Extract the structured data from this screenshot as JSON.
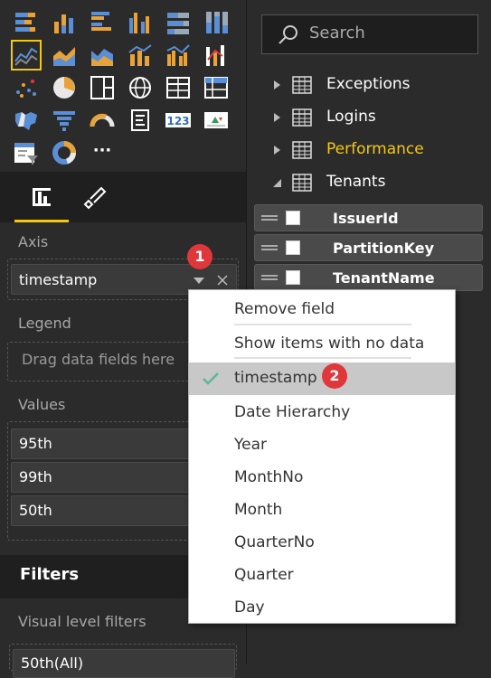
{
  "visualizations": {
    "icons": [
      "stacked-bar-chart-icon",
      "stacked-column-chart-icon",
      "clustered-bar-chart-icon",
      "clustered-column-chart-icon",
      "100pct-stacked-bar-chart-icon",
      "100pct-stacked-column-chart-icon",
      "line-chart-icon",
      "area-chart-icon",
      "stacked-area-chart-icon",
      "line-and-stacked-column-chart-icon",
      "line-and-clustered-column-chart-icon",
      "ribbon-chart-icon",
      "scatter-chart-icon",
      "pie-chart-icon",
      "treemap-icon",
      "globe-map-icon",
      "table-icon",
      "matrix-icon",
      "filled-map-icon",
      "funnel-icon",
      "gauge-icon",
      "card-icon",
      "multi-row-card-icon",
      "kpi-icon",
      "slicer-icon",
      "donut-chart-icon",
      "more-visuals-icon"
    ],
    "more_label": "···",
    "selected": "line-chart-icon"
  },
  "tabs": [
    {
      "name": "fields-tab",
      "icon": "fields-icon",
      "active": true
    },
    {
      "name": "format-tab",
      "icon": "paint-roller-icon",
      "active": false
    }
  ],
  "axis": {
    "label": "Axis",
    "value": "timestamp"
  },
  "legend": {
    "label": "Legend",
    "placeholder": "Drag data fields here"
  },
  "values": {
    "label": "Values",
    "fields": [
      "95th",
      "99th",
      "50th"
    ]
  },
  "filters": {
    "header": "Filters",
    "visual_level_label": "Visual level filters",
    "first_filter": "50th(All)"
  },
  "search": {
    "placeholder": "Search"
  },
  "tables": [
    {
      "name": "Exceptions",
      "expanded": false,
      "color": "#ffffff"
    },
    {
      "name": "Logins",
      "expanded": false,
      "color": "#ffffff"
    },
    {
      "name": "Performance",
      "expanded": false,
      "color": "#f2c811"
    },
    {
      "name": "Tenants",
      "expanded": true,
      "color": "#ffffff"
    }
  ],
  "tenant_fields": [
    "IssuerId",
    "PartitionKey",
    "TenantName"
  ],
  "context_menu": {
    "items": [
      "Remove field",
      "Show items with no data",
      "timestamp",
      "Date Hierarchy",
      "Year",
      "MonthNo",
      "Month",
      "QuarterNo",
      "Quarter",
      "Day"
    ],
    "checked": "timestamp"
  },
  "badges": [
    "1",
    "2"
  ],
  "colors": {
    "accent": "#f2c811",
    "badge": "#e0373b",
    "check": "#5cb89a"
  }
}
